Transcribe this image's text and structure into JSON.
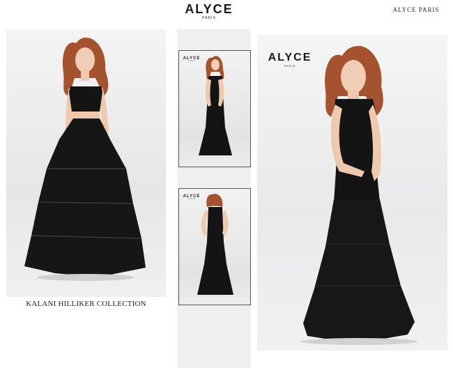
{
  "header": {
    "logo_word": "ALYCE",
    "logo_sub": "PARIS",
    "brand_text": "ALYCE PARIS"
  },
  "left_panel": {
    "caption": "KALANI HILLIKER COLLECTION"
  },
  "thumbnails": [
    {
      "logo_word": "ALYCE",
      "logo_sub": "PARIS"
    },
    {
      "logo_word": "ALYCE",
      "logo_sub": "PARIS"
    }
  ],
  "main_photo": {
    "logo_word": "ALYCE",
    "logo_sub": "PARIS"
  }
}
